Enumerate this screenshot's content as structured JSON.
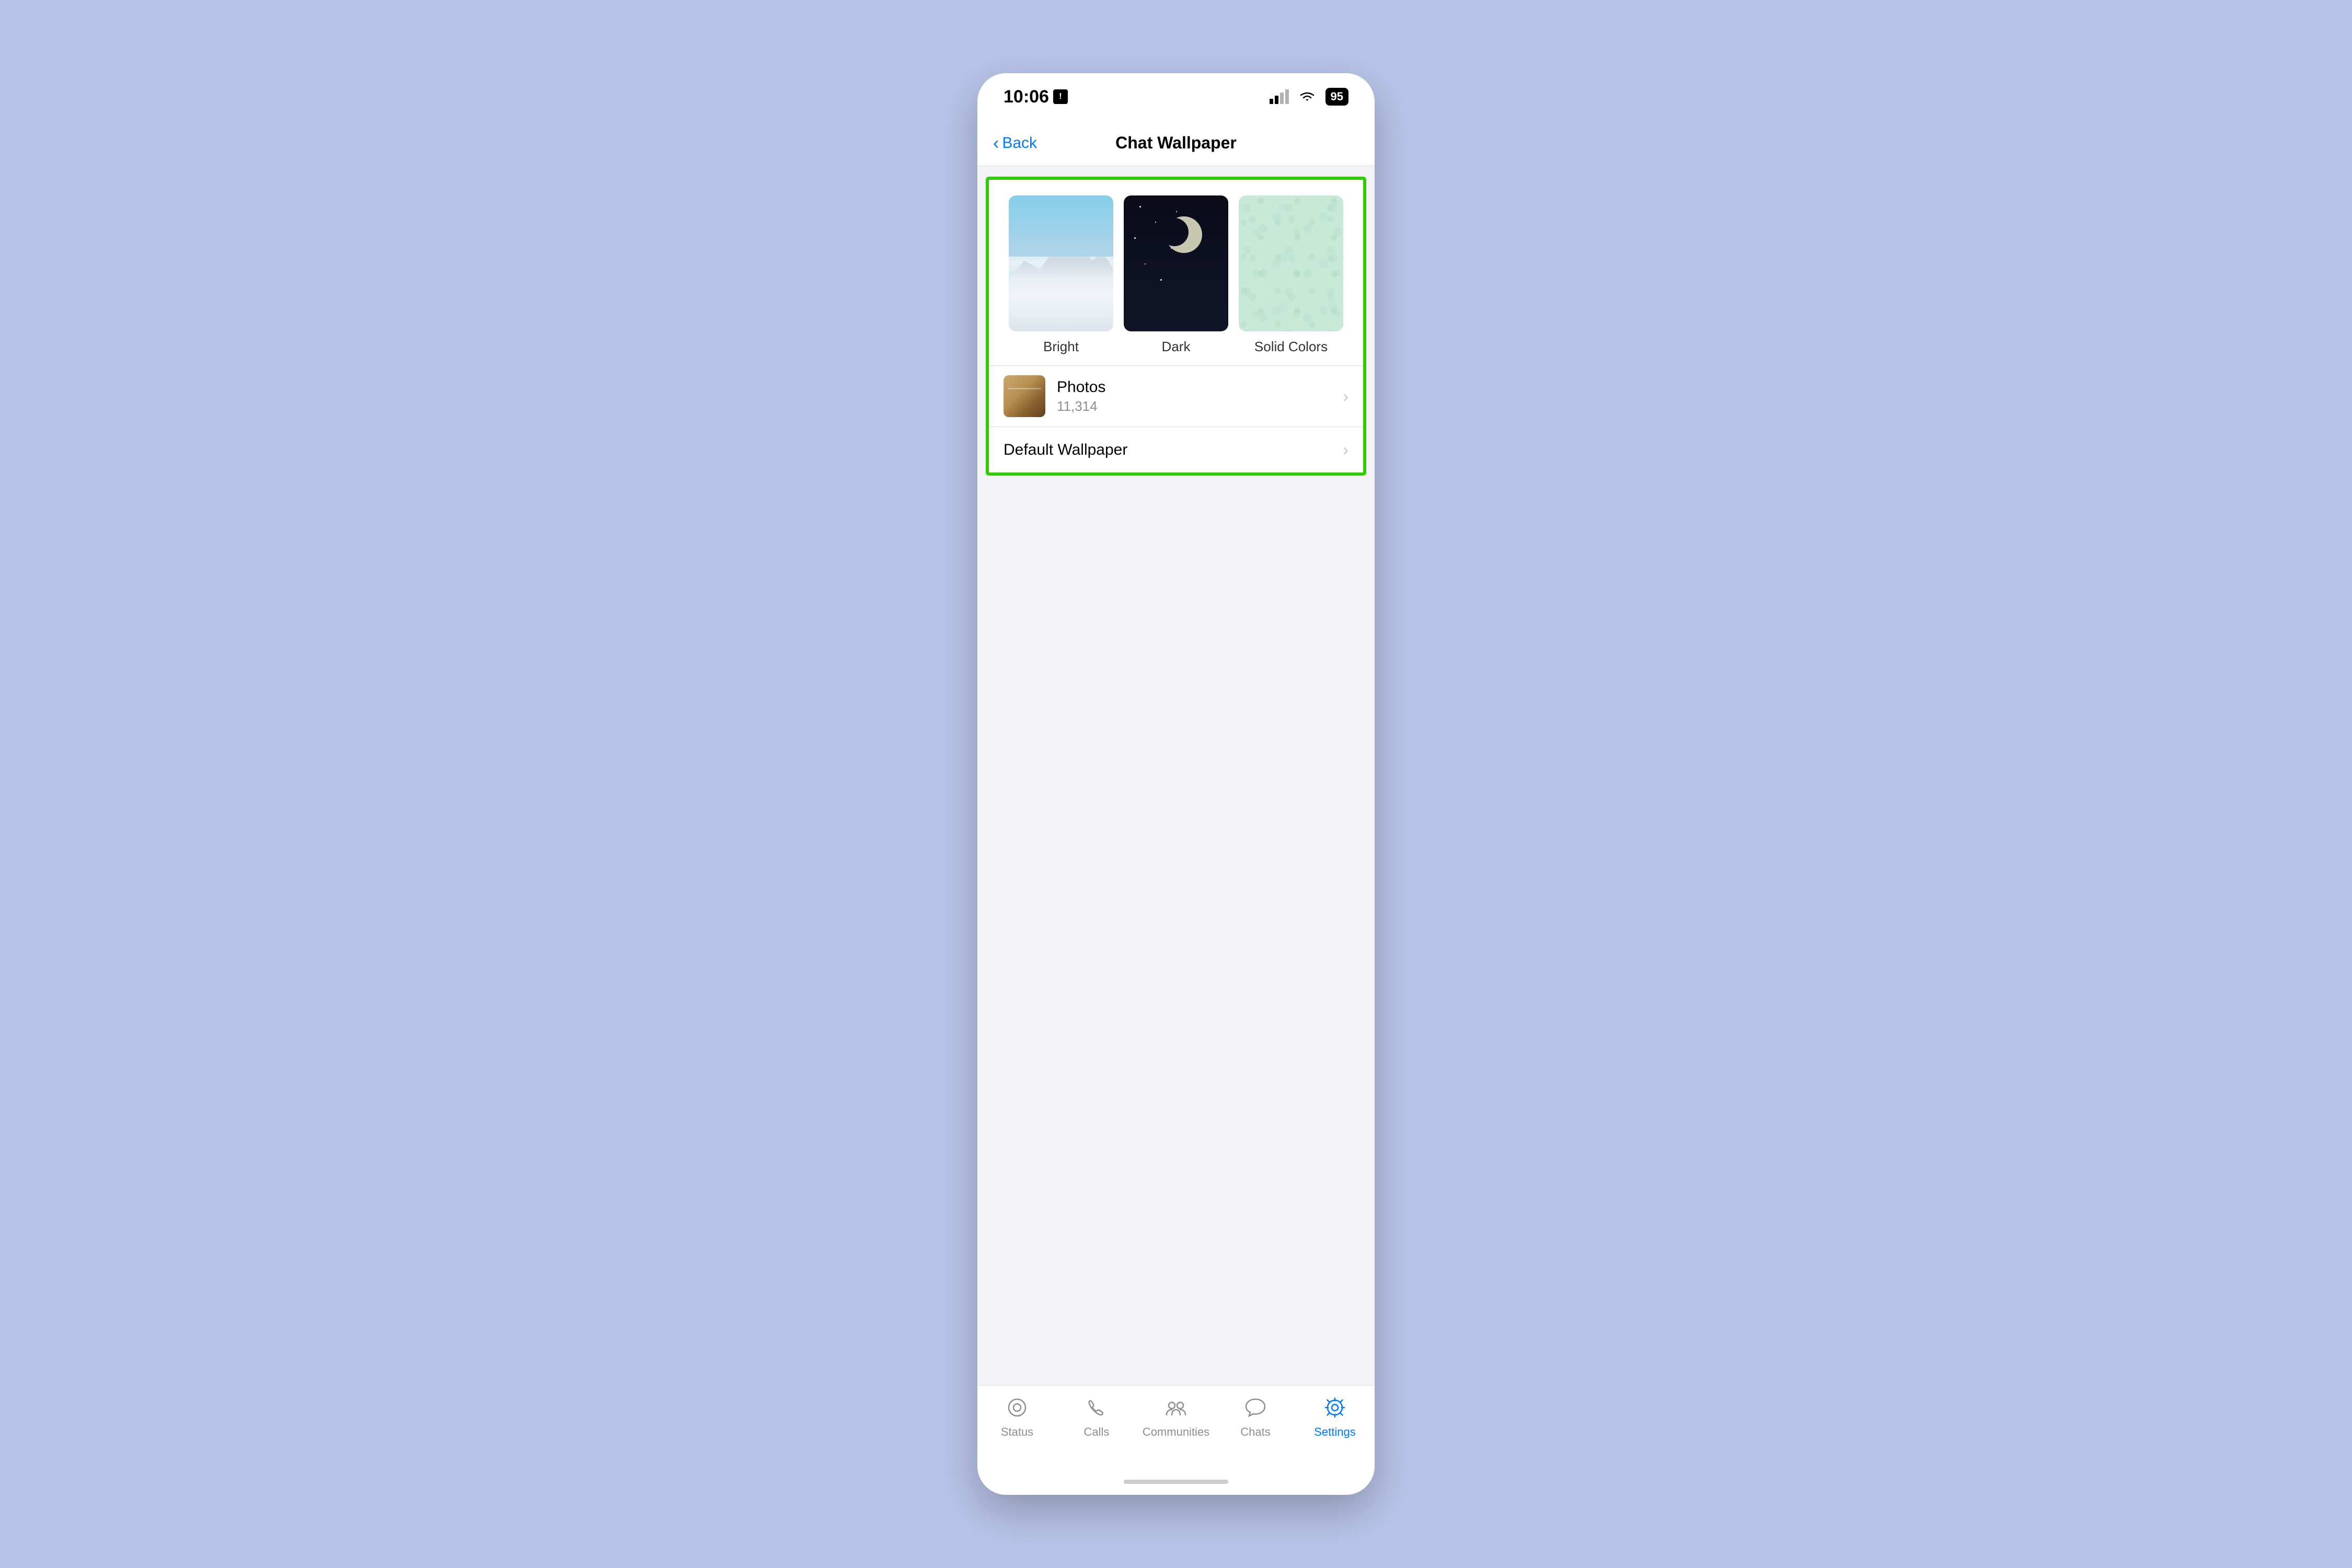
{
  "statusBar": {
    "time": "10:06",
    "batteryLevel": "95"
  },
  "navBar": {
    "backLabel": "Back",
    "title": "Chat Wallpaper"
  },
  "wallpaperOptions": {
    "items": [
      {
        "id": "bright",
        "label": "Bright"
      },
      {
        "id": "dark",
        "label": "Dark"
      },
      {
        "id": "solid-colors",
        "label": "Solid Colors"
      }
    ]
  },
  "photosList": {
    "title": "Photos",
    "count": "11,314",
    "chevron": "›"
  },
  "defaultWallpaper": {
    "label": "Default Wallpaper",
    "chevron": "›"
  },
  "tabBar": {
    "items": [
      {
        "id": "status",
        "label": "Status"
      },
      {
        "id": "calls",
        "label": "Calls"
      },
      {
        "id": "communities",
        "label": "Communities"
      },
      {
        "id": "chats",
        "label": "Chats"
      },
      {
        "id": "settings",
        "label": "Settings",
        "active": true
      }
    ]
  }
}
